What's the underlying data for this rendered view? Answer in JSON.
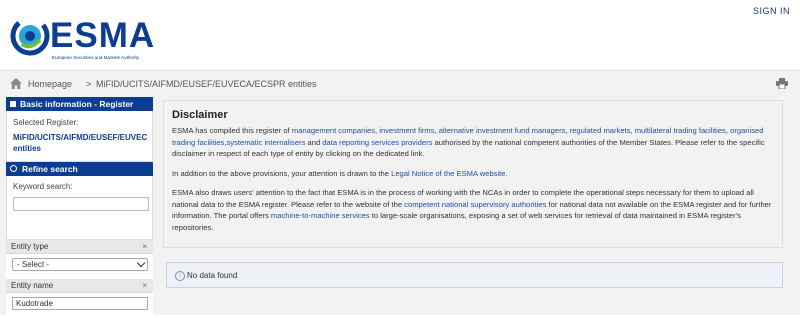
{
  "header": {
    "logo_text": "ESMA",
    "logo_subtitle": "European Securities and Markets Authority",
    "signin_label": "SIGN IN"
  },
  "breadcrumb": {
    "home": "Homepage",
    "separator": ">",
    "current": "MiFID/UCITS/AIFMD/EUSEF/EUVECA/ECSPR entities"
  },
  "sidebar": {
    "basic_info_title": "Basic information - Register",
    "selected_register_label": "Selected Register:",
    "selected_register_value_line1": "MiFID/UCITS/AIFMD/EUSEF/EUVEC",
    "selected_register_value_line2": "entities",
    "refine_title": "Refine search",
    "keyword_label": "Keyword search:",
    "keyword_value": "",
    "entity_type_label": "Entity type",
    "entity_type_selected": "- Select -",
    "entity_name_label": "Entity name",
    "entity_name_value": "Kudotrade",
    "close_glyph": "×"
  },
  "disclaimer": {
    "title": "Disclaimer",
    "p1": {
      "t0": "ESMA has compiled this register of ",
      "l1": "management companies",
      "t1": ", ",
      "l2": "investment firms",
      "t2": ", ",
      "l3": "alternative investment fund managers",
      "t3": ", ",
      "l4": "regulated markets",
      "t4": ", ",
      "l5": "multilateral trading facilities",
      "t5": ", ",
      "l6": "organised trading facilities",
      "t6": ",",
      "l7": "systematic internalisers",
      "t7": " and ",
      "l8": "data reporting services providers",
      "t8": " authorised by the national competent authorities of the Member States. Please refer to the specific disclaimer in respect of each type of entity by clicking on the dedicated link."
    },
    "p2": {
      "t0": "In addition to the above provisions, your attention is drawn to the ",
      "l1": "Legal Notice of the ESMA website",
      "t1": "."
    },
    "p3": {
      "t0": "ESMA also draws users' attention to the fact that ESMA is in the process of working with the NCAs in order to complete the operational steps necessary for them to upload all national data to the ESMA register. Please refer to the website of the ",
      "l1": "competent national supervisory authorities",
      "t1": " for national data not available on the ESMA register and for further information. The portal offers ",
      "l2": "machine-to-machine services",
      "t2": " to large-scale organisations, exposing a set of web services for retrieval of data maintained in ESMA register's repositories."
    }
  },
  "results": {
    "no_data_text": "No data found"
  },
  "icons": {
    "home": "home-icon",
    "print": "print-icon",
    "info": "info-icon"
  },
  "colors": {
    "brand_blue": "#0b3d91",
    "link_blue": "#1f4fa3",
    "panel_gray": "#f2f2f2"
  }
}
